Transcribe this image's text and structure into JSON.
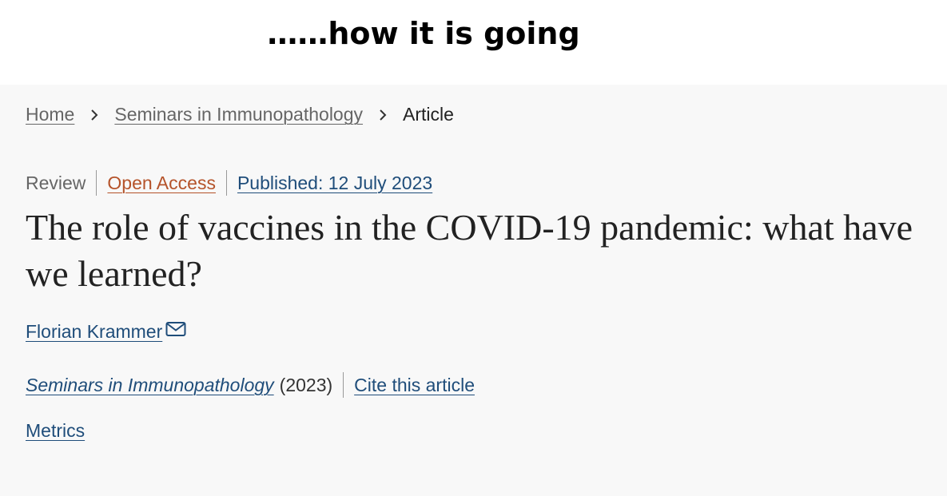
{
  "caption": "……how it is going",
  "breadcrumb": {
    "items": [
      {
        "label": "Home"
      },
      {
        "label": "Seminars in Immunopathology"
      }
    ],
    "current": "Article"
  },
  "meta": {
    "type": "Review",
    "access": "Open Access",
    "published": "Published: 12 July 2023"
  },
  "article": {
    "title": "The role of vaccines in the COVID-19 pandemic: what have we learned?",
    "author": "Florian Krammer",
    "author_icon": "mail-icon",
    "journal": "Seminars in Immunopathology",
    "year": "(2023)",
    "cite_label": "Cite this article",
    "metrics_label": "Metrics"
  },
  "colors": {
    "link": "#1f4d7a",
    "open_access": "#b5532a",
    "muted": "#666666",
    "panel_background": "#f8f8f8"
  }
}
